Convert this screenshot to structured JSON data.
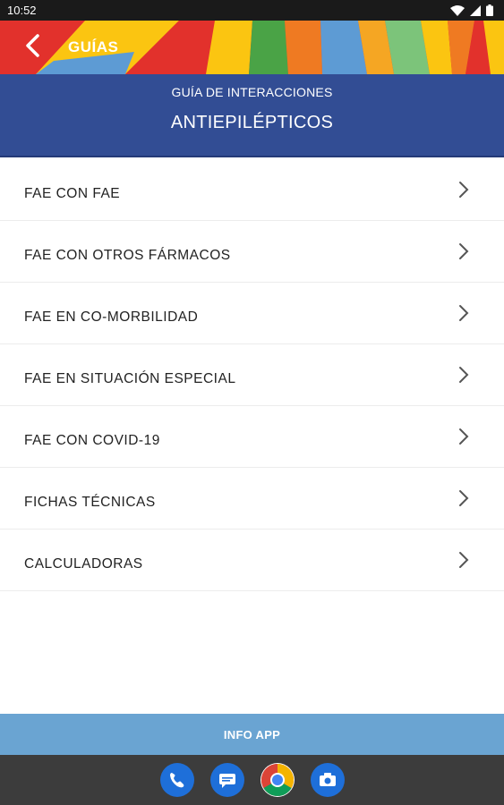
{
  "status_bar": {
    "time": "10:52",
    "icons": [
      "wifi-icon",
      "signal-icon",
      "battery-icon"
    ]
  },
  "header": {
    "back_icon": "chevron-left-icon",
    "title": "GUÍAS",
    "stripe_colors": [
      "#e2312c",
      "#fbc511",
      "#4aa346",
      "#ef7a22",
      "#5d9bd4",
      "#7cc47a",
      "#f5a623"
    ]
  },
  "title_band": {
    "subtitle": "GUÍA DE INTERACCIONES",
    "title": "ANTIEPILÉPTICOS",
    "color": "#324d94"
  },
  "menu": {
    "items": [
      {
        "label": "FAE CON FAE"
      },
      {
        "label": "FAE CON OTROS FÁRMACOS"
      },
      {
        "label": "FAE EN CO-MORBILIDAD"
      },
      {
        "label": "FAE EN SITUACIÓN ESPECIAL"
      },
      {
        "label": "FAE CON COVID-19"
      },
      {
        "label": "FICHAS TÉCNICAS"
      },
      {
        "label": "CALCULADORAS"
      }
    ],
    "chevron_icon": "chevron-right-icon"
  },
  "info_button": {
    "label": "INFO APP",
    "color": "#6aa4d2"
  },
  "dock": {
    "apps": [
      "phone-icon",
      "messages-icon",
      "chrome-icon",
      "camera-icon"
    ]
  }
}
